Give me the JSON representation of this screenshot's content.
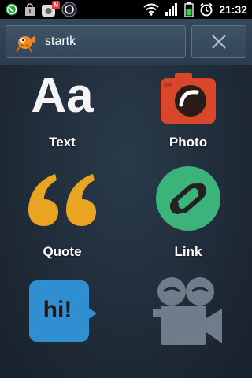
{
  "status_bar": {
    "time": "21:32",
    "notification_badge": "N",
    "icons": [
      "whatsapp-icon",
      "shopping-bag-icon",
      "camera-notification-icon",
      "circle-app-icon",
      "wifi-icon",
      "signal-icon",
      "battery-icon",
      "alarm-icon"
    ]
  },
  "header": {
    "account_name": "startk",
    "close_icon": "close-icon"
  },
  "post_types": [
    {
      "label": "Text",
      "icon": "text-aa-icon"
    },
    {
      "label": "Photo",
      "icon": "camera-icon"
    },
    {
      "label": "Quote",
      "icon": "quote-icon"
    },
    {
      "label": "Link",
      "icon": "link-icon"
    },
    {
      "label": "",
      "icon": "chat-bubble-icon",
      "bubble_text": "hi!"
    },
    {
      "label": "",
      "icon": "video-camera-icon"
    }
  ],
  "colors": {
    "background": "#1e2a36",
    "photo": "#d9472b",
    "quote": "#e9a521",
    "link": "#3bb37a",
    "chat": "#2f8fd0",
    "video": "#6f7c89"
  }
}
